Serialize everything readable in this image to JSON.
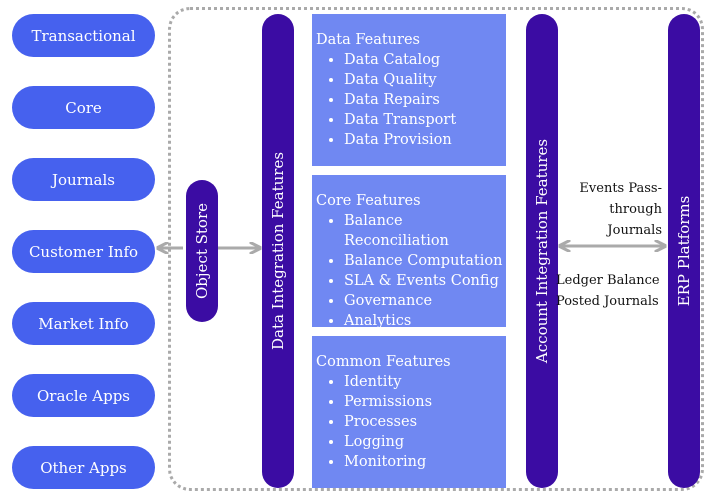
{
  "sources": [
    "Transactional",
    "Core",
    "Journals",
    "Customer Info",
    "Market Info",
    "Oracle Apps",
    "Other Apps"
  ],
  "object_store": "Object Store",
  "data_integration": "Data Integration Features",
  "account_integration": "Account Integration Features",
  "erp": "ERP Platforms",
  "boxes": [
    {
      "title": "Data Features",
      "items": [
        "Data Catalog",
        "Data Quality",
        "Data Repairs",
        "Data Transport",
        "Data Provision"
      ]
    },
    {
      "title": "Core Features",
      "items": [
        "Balance Reconciliation",
        "Balance Computation",
        "SLA & Events Config",
        "Governance",
        "Analytics"
      ]
    },
    {
      "title": "Common Features",
      "items": [
        "Identity",
        "Permissions",
        "Processes",
        "Logging",
        "Monitoring"
      ]
    }
  ],
  "notes": {
    "top": [
      "Events Pass-",
      "through",
      "Journals"
    ],
    "bottom": [
      "Ledger Balance",
      "Posted Journals"
    ]
  },
  "colors": {
    "source_pill": "#4661ee",
    "integration_bar": "#3b0ca3",
    "feature_box": "#7088f2",
    "arrow": "#aaaaaa"
  }
}
